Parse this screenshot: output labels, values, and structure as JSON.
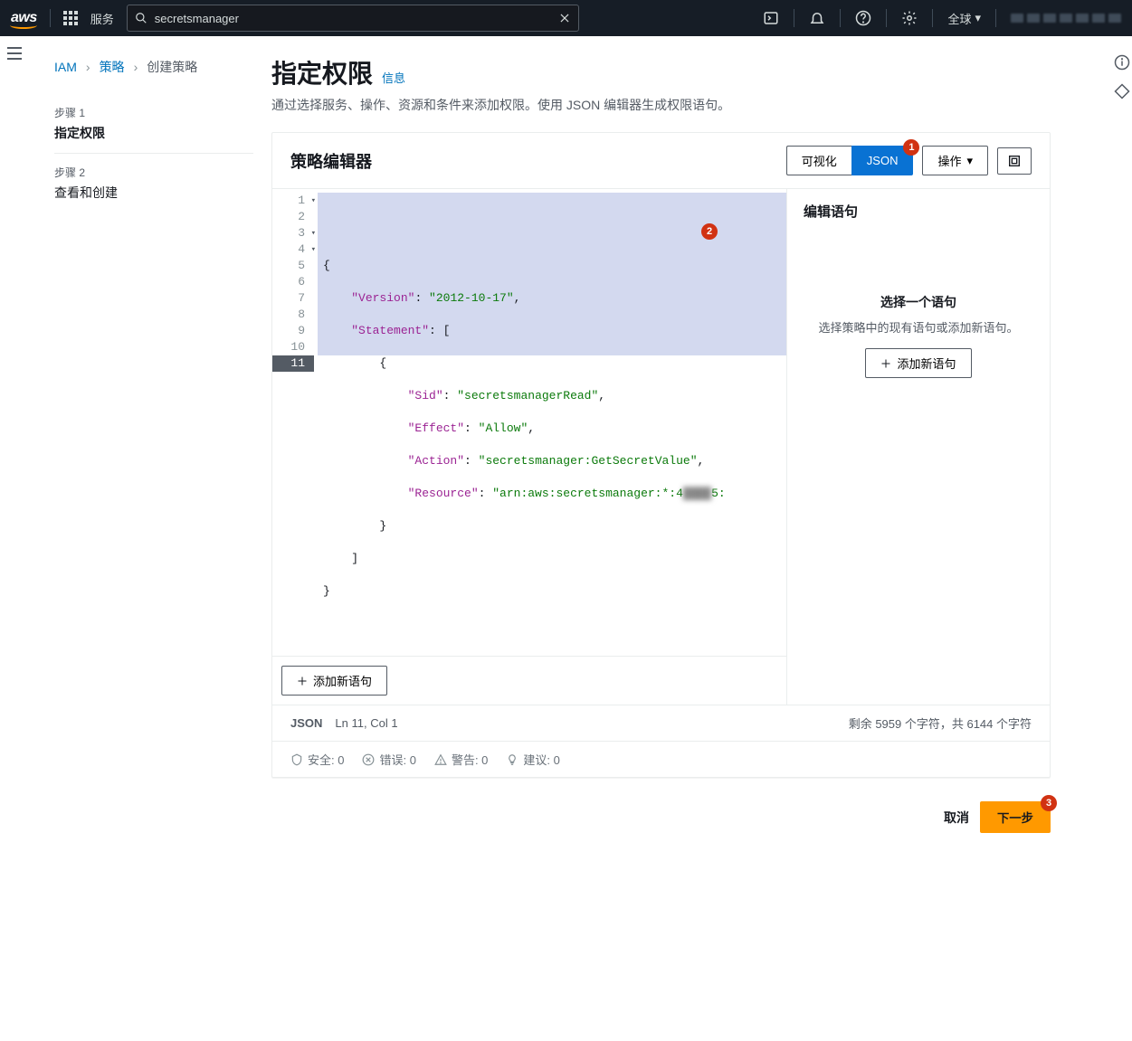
{
  "topnav": {
    "services_label": "服务",
    "search_value": "secretsmanager",
    "region_label": "全球"
  },
  "breadcrumb": {
    "iam": "IAM",
    "policies": "策略",
    "create": "创建策略"
  },
  "wizard": {
    "step1_label": "步骤 1",
    "step1_title": "指定权限",
    "step2_label": "步骤 2",
    "step2_title": "查看和创建"
  },
  "header": {
    "title": "指定权限",
    "info": "信息",
    "desc": "通过选择服务、操作、资源和条件来添加权限。使用 JSON 编辑器生成权限语句。"
  },
  "editor_panel": {
    "title": "策略编辑器",
    "visual": "可视化",
    "json": "JSON",
    "actions": "操作",
    "add_stmt": "添加新语句",
    "badge1": "1",
    "badge2": "2"
  },
  "code": {
    "line1": "{",
    "line2_k": "\"Version\"",
    "line2_v": "\"2012-10-17\"",
    "line3_k": "\"Statement\"",
    "line4": "{",
    "line5_k": "\"Sid\"",
    "line5_v": "\"secretsmanagerRead\"",
    "line6_k": "\"Effect\"",
    "line6_v": "\"Allow\"",
    "line7_k": "\"Action\"",
    "line7_v": "\"secretsmanager:GetSecretValue\"",
    "line8_k": "\"Resource\"",
    "line8_v1": "\"arn:aws:secretsmanager:*:4",
    "line8_v2": "5:",
    "line9": "}",
    "line10": "]",
    "line11": "}"
  },
  "stmt_panel": {
    "title": "编辑语句",
    "empty_title": "选择一个语句",
    "empty_desc": "选择策略中的现有语句或添加新语句。",
    "add_btn": "添加新语句"
  },
  "status": {
    "mode": "JSON",
    "cursor": "Ln 11, Col 1",
    "chars": "剩余 5959 个字符，共 6144 个字符"
  },
  "checks": {
    "security": "安全: 0",
    "errors": "错误: 0",
    "warnings": "警告: 0",
    "suggestions": "建议: 0"
  },
  "footer": {
    "cancel": "取消",
    "next": "下一步",
    "badge3": "3"
  }
}
